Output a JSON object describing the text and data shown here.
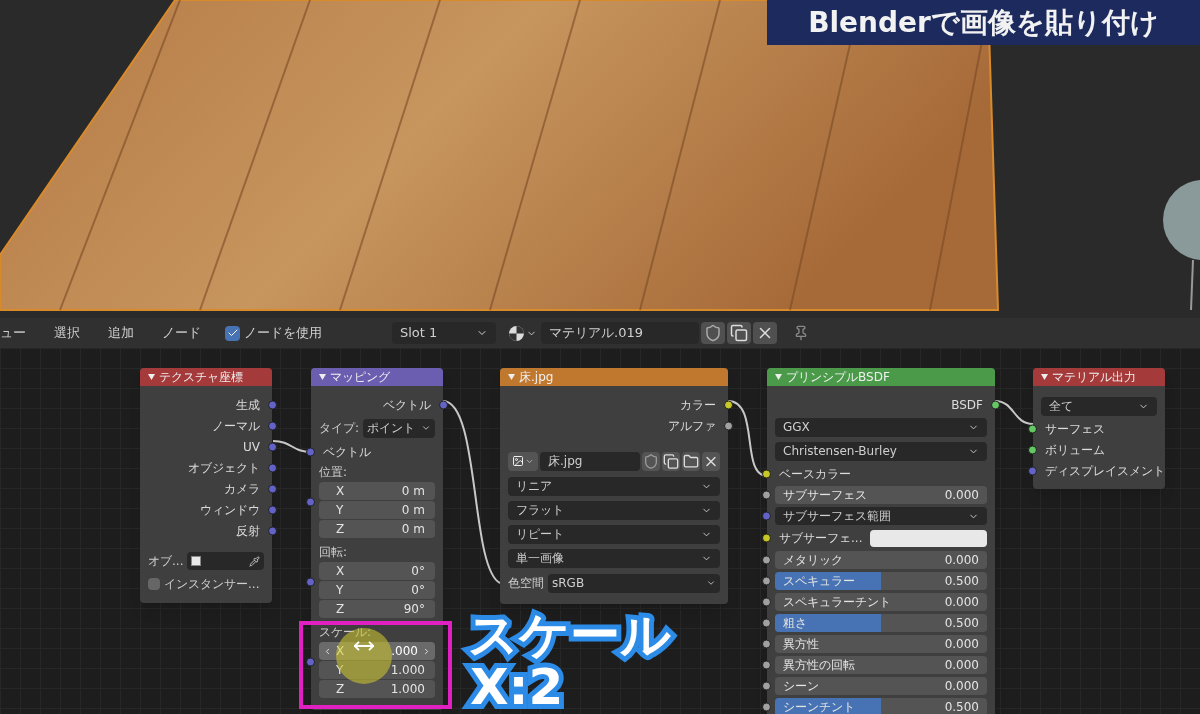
{
  "banner": "Blenderで画像を貼り付け",
  "header": {
    "menus": [
      "ュー",
      "選択",
      "追加",
      "ノード"
    ],
    "use_nodes": {
      "label": "ノードを使用",
      "checked": true
    },
    "slot": "Slot 1",
    "material": "マテリアル.019"
  },
  "nodes": [
    {
      "kind": "texture",
      "title": "テクスチャ座標",
      "rows": [
        {
          "kind": "output",
          "label": "生成",
          "color": "#6363c7"
        },
        {
          "kind": "output",
          "label": "ノーマル",
          "color": "#6363c7"
        },
        {
          "kind": "output",
          "label": "UV",
          "color": "#6363c7"
        },
        {
          "kind": "output",
          "label": "オブジェクト",
          "color": "#6363c7"
        },
        {
          "kind": "output",
          "label": "カメラ",
          "color": "#6363c7"
        },
        {
          "kind": "output",
          "label": "ウィンドウ",
          "color": "#6363c7"
        },
        {
          "kind": "output",
          "label": "反射",
          "color": "#6363c7"
        },
        {
          "kind": "object",
          "label": "オブ..."
        },
        {
          "kind": "checkbox",
          "label": "インスタンサー...",
          "checked": false
        }
      ]
    },
    {
      "kind": "vector",
      "title": "マッピング",
      "rows": [
        {
          "kind": "output",
          "label": "ベクトル",
          "color": "#6363c7"
        },
        {
          "kind": "enum",
          "label": "タイプ:",
          "value": "ポイント"
        },
        {
          "kind": "input",
          "label": "ベクトル",
          "color": "#6363c7"
        },
        {
          "kind": "group",
          "label": "位置:",
          "fields": [
            {
              "axis": "X",
              "value": "0 m",
              "hovered": false
            },
            {
              "axis": "Y",
              "value": "0 m",
              "hovered": false
            },
            {
              "axis": "Z",
              "value": "0 m",
              "hovered": false
            }
          ]
        },
        {
          "kind": "group",
          "label": "回転:",
          "fields": [
            {
              "axis": "X",
              "value": "0°",
              "hovered": false
            },
            {
              "axis": "Y",
              "value": "0°",
              "hovered": false
            },
            {
              "axis": "Z",
              "value": "90°",
              "hovered": false
            }
          ]
        },
        {
          "kind": "group",
          "label": "スケール:",
          "fields": [
            {
              "axis": "X",
              "value": ".000",
              "hovered": true
            },
            {
              "axis": "Y",
              "value": "1.000",
              "hovered": false
            },
            {
              "axis": "Z",
              "value": "1.000",
              "hovered": false
            }
          ]
        }
      ]
    },
    {
      "kind": "texture_image",
      "title": "床.jpg",
      "rows": [
        {
          "kind": "output",
          "label": "カラー",
          "color": "#c7c729"
        },
        {
          "kind": "output",
          "label": "アルファ",
          "color": "#a1a1a1"
        },
        {
          "kind": "image",
          "value": "床.jpg"
        },
        {
          "kind": "dropdown",
          "value": "リニア"
        },
        {
          "kind": "dropdown",
          "value": "フラット"
        },
        {
          "kind": "dropdown",
          "value": "リピート"
        },
        {
          "kind": "dropdown",
          "value": "単一画像"
        },
        {
          "kind": "enum",
          "label": "色空間",
          "value": "sRGB"
        }
      ]
    },
    {
      "kind": "shader",
      "title": "プリンシプルBSDF",
      "rows": [
        {
          "kind": "output",
          "label": "BSDF",
          "color": "#63c763"
        },
        {
          "kind": "dropdown",
          "value": "GGX"
        },
        {
          "kind": "dropdown",
          "value": "Christensen-Burley"
        },
        {
          "kind": "input",
          "label": "ベースカラー",
          "color": "#c7c729"
        },
        {
          "kind": "slider",
          "label": "サブサーフェス",
          "value": "0.000",
          "level": 0,
          "color": "#a1a1a1"
        },
        {
          "kind": "input_dropdown",
          "label": "サブサーフェス範囲",
          "color": "#6363c7"
        },
        {
          "kind": "input_color",
          "label": "サブサーフェ...",
          "color": "#c7c729"
        },
        {
          "kind": "slider",
          "label": "メタリック",
          "value": "0.000",
          "level": 0,
          "color": "#a1a1a1"
        },
        {
          "kind": "slider",
          "label": "スペキュラー",
          "value": "0.500",
          "level": 0.5,
          "color": "#a1a1a1"
        },
        {
          "kind": "slider",
          "label": "スペキュラーチント",
          "value": "0.000",
          "level": 0,
          "color": "#a1a1a1"
        },
        {
          "kind": "slider",
          "label": "粗さ",
          "value": "0.500",
          "level": 0.5,
          "color": "#a1a1a1"
        },
        {
          "kind": "slider",
          "label": "異方性",
          "value": "0.000",
          "level": 0,
          "color": "#a1a1a1"
        },
        {
          "kind": "slider",
          "label": "異方性の回転",
          "value": "0.000",
          "level": 0,
          "color": "#a1a1a1"
        },
        {
          "kind": "slider",
          "label": "シーン",
          "value": "0.000",
          "level": 0,
          "color": "#a1a1a1"
        },
        {
          "kind": "slider",
          "label": "シーンチント",
          "value": "0.500",
          "level": 0.5,
          "color": "#a1a1a1"
        }
      ]
    },
    {
      "kind": "output_node",
      "title": "マテリアル出力",
      "rows": [
        {
          "kind": "dropdown",
          "value": "全て"
        },
        {
          "kind": "input",
          "label": "サーフェス",
          "color": "#63c763"
        },
        {
          "kind": "input",
          "label": "ボリューム",
          "color": "#63c763"
        },
        {
          "kind": "input",
          "label": "ディスプレイスメント",
          "color": "#6363c7"
        }
      ]
    }
  ],
  "caption": {
    "title": "スケール",
    "value": "X:2"
  }
}
